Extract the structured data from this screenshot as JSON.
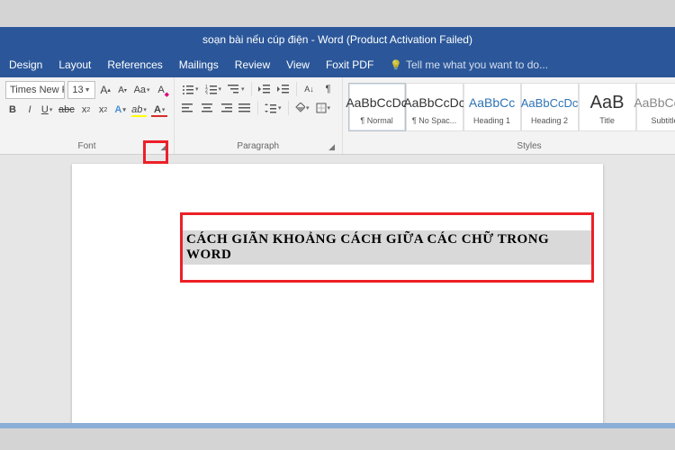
{
  "titlebar": {
    "text": "soạn bài nếu cúp điện - Word (Product Activation Failed)"
  },
  "menu": {
    "design": "Design",
    "layout": "Layout",
    "references": "References",
    "mailings": "Mailings",
    "review": "Review",
    "view": "View",
    "foxit": "Foxit PDF",
    "tellme": "Tell me what you want to do..."
  },
  "font": {
    "name": "Times New Ro",
    "size": "13",
    "group_label": "Font"
  },
  "paragraph": {
    "group_label": "Paragraph"
  },
  "styles": {
    "group_label": "Styles",
    "preview": "AaBbCcDc",
    "preview2": "AaBbCc",
    "preview_title": "AaB",
    "items": [
      {
        "name": "¶ Normal"
      },
      {
        "name": "¶ No Spac..."
      },
      {
        "name": "Heading 1"
      },
      {
        "name": "Heading 2"
      },
      {
        "name": "Title"
      },
      {
        "name": "Subtitle"
      }
    ]
  },
  "document": {
    "selected_text": "CÁCH GIÃN KHOẢNG CÁCH GIỮA CÁC CHỮ TRONG WORD"
  }
}
